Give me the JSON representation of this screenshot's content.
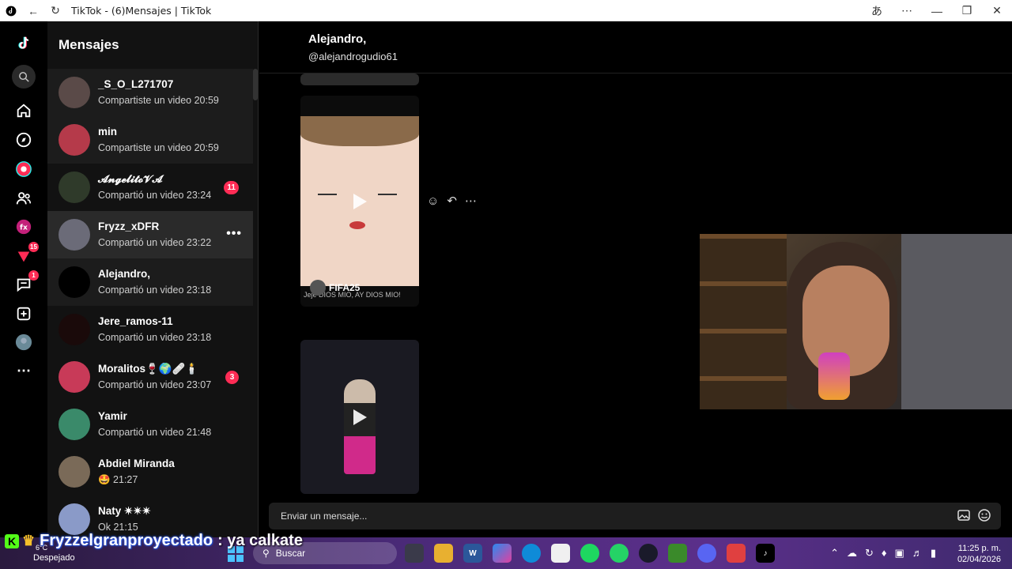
{
  "window": {
    "title": "TikTok - (6)Mensajes | TikTok"
  },
  "rail": {
    "badges": {
      "inbox": "15",
      "messages": "1"
    }
  },
  "conversations": {
    "header": "Mensajes",
    "items": [
      {
        "name": "_S_O_L271707",
        "sub": "Compartiste un video 20:59",
        "unread": "",
        "avatar_color": "#5a4a48"
      },
      {
        "name": "min",
        "sub": "Compartiste un video 20:59",
        "unread": "",
        "avatar_color": "#b53a4a"
      },
      {
        "name": "𝓐𝓷𝓰𝓮𝓵𝓲𝓽𝓸𝓥𝓐",
        "sub": "Compartió un video 23:24",
        "unread": "11",
        "avatar_color": "#2f3a2a"
      },
      {
        "name": "Fryzz_xDFR",
        "sub": "Compartió un video 23:22",
        "unread": "",
        "avatar_color": "#6b6b78"
      },
      {
        "name": "Alejandro,",
        "sub": "Compartió un video 23:18",
        "unread": "",
        "avatar_color": "#000000"
      },
      {
        "name": "Jere_ramos-11",
        "sub": "Compartió un video 23:18",
        "unread": "",
        "avatar_color": "#1a0a0a"
      },
      {
        "name": "Moralitos🍷🌍🩹🕯️",
        "sub": "Compartió un video 23:07",
        "unread": "3",
        "avatar_color": "#c83a58"
      },
      {
        "name": "Yamir",
        "sub": "Compartió un video 21:48",
        "unread": "",
        "avatar_color": "#3a8a6a"
      },
      {
        "name": "Abdiel Miranda",
        "sub": "🤩 21:27",
        "unread": "",
        "avatar_color": "#7a6a58"
      },
      {
        "name": "Naty ✴✴✴",
        "sub": "Ok 21:15",
        "unread": "",
        "avatar_color": "#8a9ac8"
      }
    ]
  },
  "chat": {
    "name": "Alejandro,",
    "handle": "@alejandrogudio61",
    "card1": {
      "label": "FIFA25",
      "caption": "Jeje DIOS MIO, AY DIOS MIO!"
    },
    "input_placeholder": "Enviar un mensaje..."
  },
  "overlay": {
    "user": "Fryzzelgranproyectado",
    "message": ": ya calkate"
  },
  "taskbar": {
    "weather_temp": "6°C",
    "weather_desc": "Despejado",
    "search": "Buscar",
    "time": "11:25 p. m.",
    "date": "02/04/2026"
  }
}
